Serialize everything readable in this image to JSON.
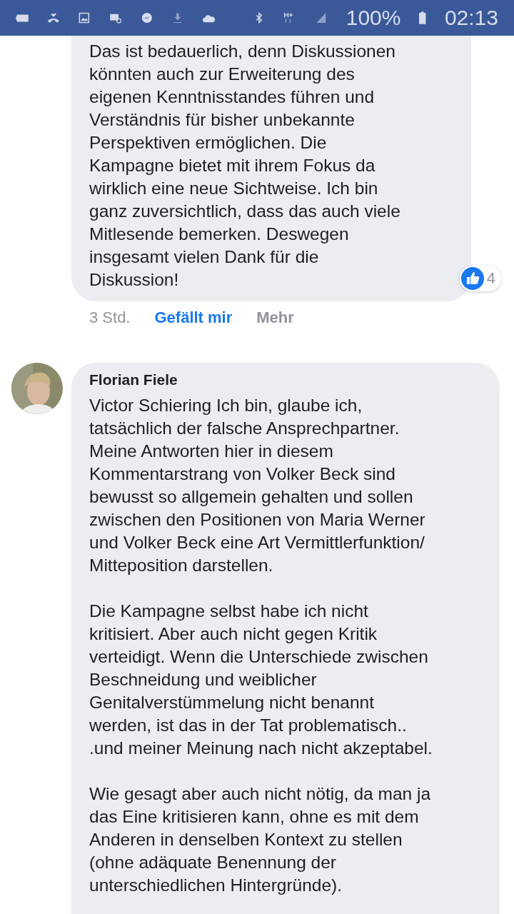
{
  "status_bar": {
    "battery": "100%",
    "time": "02:13"
  },
  "comments": [
    {
      "text": "Das ist bedauerlich, denn Diskussionen\nkönnten auch zur Erweiterung des\neigenen Kenntnisstandes führen und\nVerständnis für bisher unbekannte\nPerspektiven ermöglichen. Die\nKampagne bietet mit ihrem Fokus da\nwirklich eine neue Sichtweise. Ich bin\nganz zuversichtlich, dass das auch viele\nMitlesende bemerken. Deswegen\ninsgesamt vielen Dank für die\nDiskussion!",
      "reactions": "4",
      "time": "3 Std.",
      "like": "Gefällt mir",
      "more": "Mehr"
    },
    {
      "author": "Florian Fiele",
      "paragraphs": [
        "Victor Schiering Ich bin, glaube ich,\ntatsächlich der falsche Ansprechpartner.\nMeine Antworten hier in diesem\nKommentarstrang von Volker Beck sind\nbewusst so allgemein gehalten und sollen\nzwischen den Positionen von Maria Werner\nund Volker Beck eine Art Vermittlerfunktion/\nMitteposition darstellen.",
        "Die Kampagne selbst habe ich nicht\nkritisiert. Aber auch nicht gegen Kritik\nverteidigt. Wenn die Unterschiede zwischen\nBeschneidung und weiblicher\nGenitalverstümmelung nicht benannt\nwerden, ist das in der Tat problematisch..\n.und meiner Meinung nach nicht akzeptabel.",
        "Wie gesagt aber auch nicht nötig, da man ja\ndas Eine kritisieren kann, ohne es mit dem\nAnderen in denselben Kontext zu stellen\n(ohne adäquate Benennung der\nunterschiedlichen Hintergründe)."
      ]
    }
  ]
}
